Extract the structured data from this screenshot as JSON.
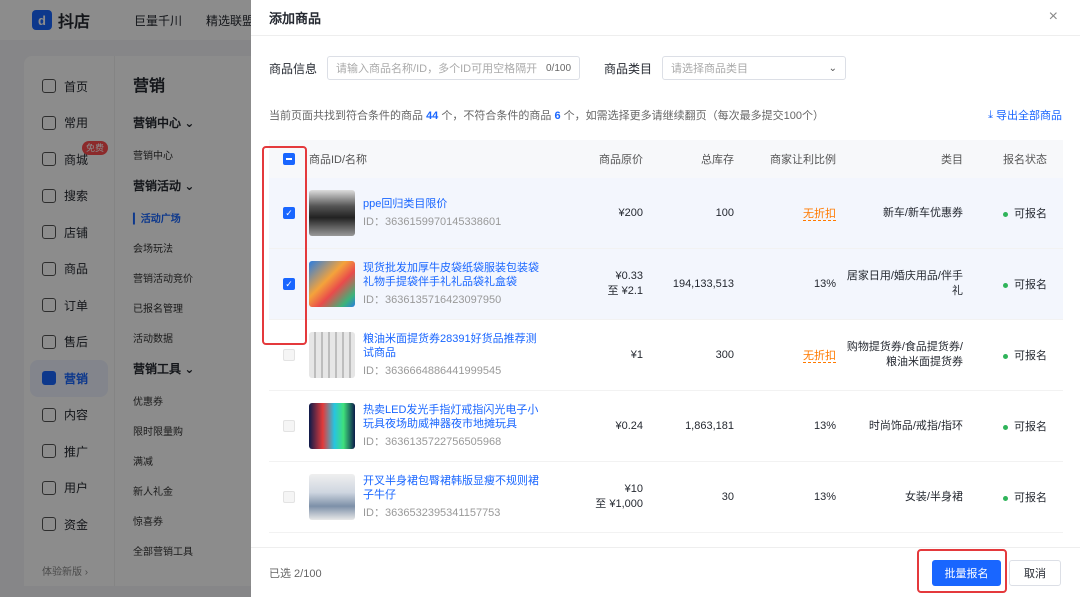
{
  "app": {
    "logo_text": "抖店",
    "logo_mark": "d",
    "topnav": [
      "巨量千川",
      "精选联盟"
    ]
  },
  "sidebar": {
    "items": [
      {
        "label": "首页",
        "icon": "home-icon"
      },
      {
        "label": "常用",
        "icon": "folder-icon"
      },
      {
        "label": "商城",
        "icon": "shop-icon",
        "badge": "免费"
      },
      {
        "label": "搜索",
        "icon": "search-icon"
      },
      {
        "label": "店铺",
        "icon": "store-icon"
      },
      {
        "label": "商品",
        "icon": "goods-icon"
      },
      {
        "label": "订单",
        "icon": "order-icon"
      },
      {
        "label": "售后",
        "icon": "aftersale-icon"
      },
      {
        "label": "营销",
        "icon": "megaphone-icon",
        "active": true
      },
      {
        "label": "内容",
        "icon": "content-icon"
      },
      {
        "label": "推广",
        "icon": "promote-icon"
      },
      {
        "label": "用户",
        "icon": "user-icon"
      },
      {
        "label": "资金",
        "icon": "money-icon"
      }
    ],
    "footer": "体验新版 ›"
  },
  "subside": {
    "title": "营销",
    "groups": [
      {
        "label": "营销中心 ⌄",
        "items": [
          "营销中心"
        ]
      },
      {
        "label": "营销活动 ⌄",
        "items": [
          "▎活动广场",
          "会场玩法",
          "营销活动竞价",
          "已报名管理",
          "活动数据"
        ]
      },
      {
        "label": "营销工具 ⌄",
        "items": [
          "优惠券",
          "限时限量购",
          "满减",
          "新人礼金",
          "惊喜券",
          "全部营销工具"
        ]
      }
    ]
  },
  "drawer": {
    "title": "添加商品",
    "close_icon": "×",
    "filter": {
      "info_label": "商品信息",
      "info_placeholder": "请输入商品名称/ID，多个ID可用空格隔开",
      "info_count": "0/100",
      "cat_label": "商品类目",
      "cat_placeholder": "请选择商品类目"
    },
    "summary": {
      "part1": "当前页面共找到符合条件的商品",
      "match_count": "44",
      "part2": "个，不符合条件的商品",
      "nomatch_count": "6",
      "part3": "个，如需选择更多请继续翻页（每次最多提交100个）"
    },
    "export_label": "导出全部商品",
    "columns": {
      "name": "商品ID/名称",
      "price": "商品原价",
      "stock": "总库存",
      "ratio": "商家让利比例",
      "category": "类目",
      "status": "报名状态"
    },
    "rows": [
      {
        "title": "ppe回归类目限价",
        "id": "ID：3636159970145338601",
        "price": "¥200",
        "price2": "",
        "stock": "100",
        "ratio": "无折扣",
        "ratio_nodisc": true,
        "category": "新车/新车优惠券",
        "status": "可报名",
        "checked": true
      },
      {
        "title": "现货批发加厚牛皮袋纸袋服装包装袋礼物手提袋伴手礼礼品袋礼盒袋",
        "id": "ID：3636135716423097950",
        "price": "¥0.33",
        "price2": "至 ¥2.1",
        "stock": "194,133,513",
        "ratio": "13%",
        "ratio_nodisc": false,
        "category": "居家日用/婚庆用品/伴手礼",
        "status": "可报名",
        "checked": true
      },
      {
        "title": "粮油米面提货券28391好货品推荐测试商品",
        "id": "ID：3636664886441999545",
        "price": "¥1",
        "price2": "",
        "stock": "300",
        "ratio": "无折扣",
        "ratio_nodisc": true,
        "category": "购物提货券/食品提货券/粮油米面提货券",
        "status": "可报名",
        "checked": false
      },
      {
        "title": "热卖LED发光手指灯戒指闪光电子小玩具夜场助威神器夜市地摊玩具",
        "id": "ID：3636135722756505968",
        "price": "¥0.24",
        "price2": "",
        "stock": "1,863,181",
        "ratio": "13%",
        "ratio_nodisc": false,
        "category": "时尚饰品/戒指/指环",
        "status": "可报名",
        "checked": false
      },
      {
        "title": "开叉半身裙包臀裙韩版显瘦不规则裙子牛仔",
        "id": "ID：3636532395341157753",
        "price": "¥10",
        "price2": "至 ¥1,000",
        "stock": "30",
        "ratio": "13%",
        "ratio_nodisc": false,
        "category": "女装/半身裙",
        "status": "可报名",
        "checked": false
      }
    ],
    "footer": {
      "selected": "已选 2/100",
      "submit": "批量报名",
      "cancel": "取消"
    }
  },
  "colors": {
    "accent": "#1966ff",
    "highlight": "#e4393c",
    "status_ok": "#2fb45a",
    "warn": "#ff7a00"
  }
}
